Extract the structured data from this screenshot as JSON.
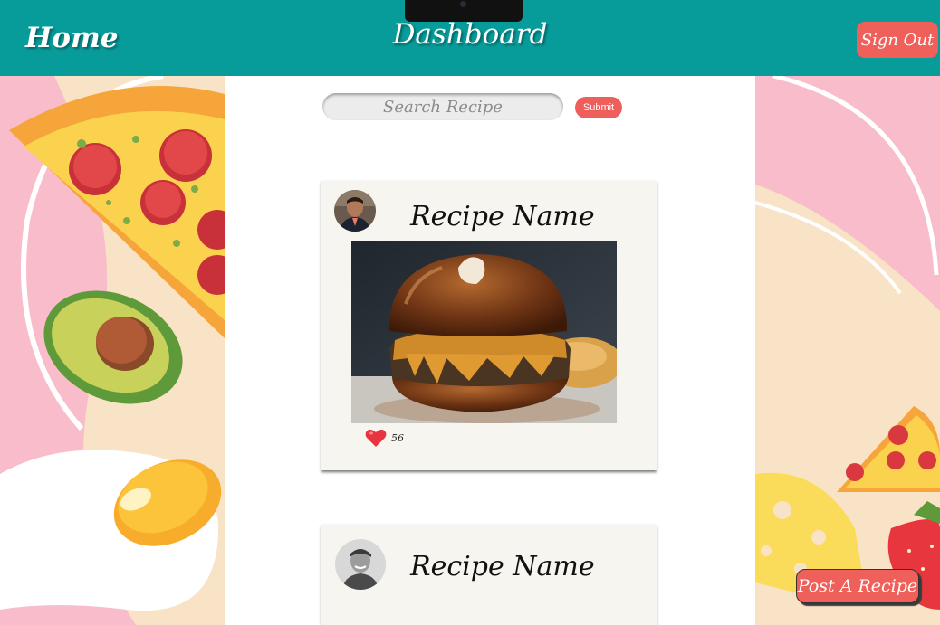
{
  "header": {
    "home_label": "Home",
    "title": "Dashboard",
    "signout_label": "Sign Out"
  },
  "search": {
    "placeholder": "Search Recipe",
    "submit_label": "Submit"
  },
  "recipes": [
    {
      "name": "Recipe Name",
      "likes": "56"
    },
    {
      "name": "Recipe Name"
    }
  ],
  "post_recipe_label": "Post A Recipe",
  "colors": {
    "header": "#079b99",
    "accent_button": "#f0605a",
    "background_pink": "#f9bccb",
    "card": "#f6f5f0"
  },
  "icons": [
    "heart-icon",
    "avatar-photo",
    "burger-photo",
    "pizza-illustration",
    "avocado-illustration",
    "egg-illustration",
    "cheese-illustration",
    "strawberry-illustration"
  ]
}
